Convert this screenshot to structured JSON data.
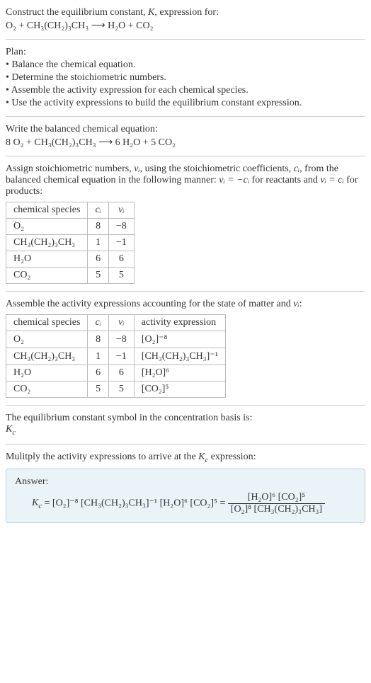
{
  "header": {
    "line1_pre": "Construct the equilibrium constant, ",
    "line1_K": "K",
    "line1_post": ", expression for:",
    "equation": "O₂ + CH₃(CH₂)₃CH₃  ⟶  H₂O + CO₂"
  },
  "plan": {
    "title": "Plan:",
    "items": [
      "• Balance the chemical equation.",
      "• Determine the stoichiometric numbers.",
      "• Assemble the activity expression for each chemical species.",
      "• Use the activity expressions to build the equilibrium constant expression."
    ]
  },
  "balanced": {
    "title": "Write the balanced chemical equation:",
    "equation": "8 O₂ + CH₃(CH₂)₃CH₃  ⟶  6 H₂O + 5 CO₂"
  },
  "stoich": {
    "text_pre": "Assign stoichiometric numbers, ",
    "nu": "νᵢ",
    "text_mid1": ", using the stoichiometric coefficients, ",
    "ci": "cᵢ",
    "text_mid2": ", from the balanced chemical equation in the following manner: ",
    "rel1": "νᵢ = −cᵢ",
    "text_mid3": " for reactants and ",
    "rel2": "νᵢ = cᵢ",
    "text_end": " for products:",
    "table": {
      "headers": [
        "chemical species",
        "cᵢ",
        "νᵢ"
      ],
      "rows": [
        [
          "O₂",
          "8",
          "−8"
        ],
        [
          "CH₃(CH₂)₃CH₃",
          "1",
          "−1"
        ],
        [
          "H₂O",
          "6",
          "6"
        ],
        [
          "CO₂",
          "5",
          "5"
        ]
      ]
    }
  },
  "activity": {
    "title_pre": "Assemble the activity expressions accounting for the state of matter and ",
    "nu": "νᵢ",
    "title_post": ":",
    "table": {
      "headers": [
        "chemical species",
        "cᵢ",
        "νᵢ",
        "activity expression"
      ],
      "rows": [
        [
          "O₂",
          "8",
          "−8",
          "[O₂]⁻⁸"
        ],
        [
          "CH₃(CH₂)₃CH₃",
          "1",
          "−1",
          "[CH₃(CH₂)₃CH₃]⁻¹"
        ],
        [
          "H₂O",
          "6",
          "6",
          "[H₂O]⁶"
        ],
        [
          "CO₂",
          "5",
          "5",
          "[CO₂]⁵"
        ]
      ]
    }
  },
  "symbol": {
    "text": "The equilibrium constant symbol in the concentration basis is:",
    "kc": "K_c"
  },
  "multiply": {
    "text_pre": "Mulitply the activity expressions to arrive at the ",
    "kc": "K_c",
    "text_post": " expression:"
  },
  "answer": {
    "label": "Answer:",
    "lhs": "K_c = [O₂]⁻⁸ [CH₃(CH₂)₃CH₃]⁻¹ [H₂O]⁶ [CO₂]⁵ = ",
    "num": "[H₂O]⁶ [CO₂]⁵",
    "den": "[O₂]⁸ [CH₃(CH₂)₃CH₃]"
  }
}
